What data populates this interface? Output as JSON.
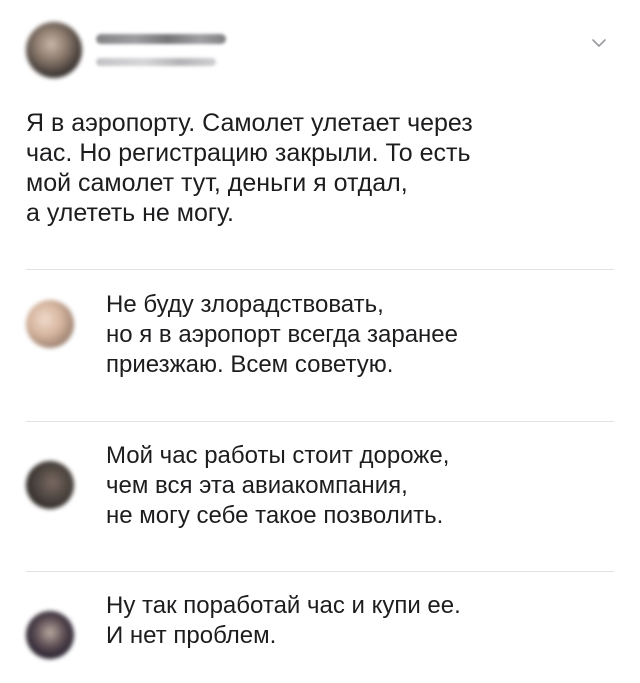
{
  "post": {
    "author_avatar": "author-avatar",
    "menu_icon": "chevron-down-icon",
    "text_lines": [
      "Я в аэропорту. Самолет улетает через",
      "час. Но регистрацию закрыли. То есть",
      "мой самолет тут, деньги я отдал,",
      "а улететь не могу."
    ]
  },
  "comments": [
    {
      "lines": [
        "Не буду злорадствовать,",
        "но я в аэропорт всегда заранее",
        "приезжаю. Всем советую."
      ]
    },
    {
      "lines": [
        "Мой час работы стоит дороже,",
        "чем вся эта авиакомпания,",
        "не могу себе такое позволить."
      ]
    },
    {
      "lines": [
        "Ну так поработай час и купи ее.",
        "И нет проблем."
      ]
    }
  ],
  "colors": {
    "text": "#1d1d1f",
    "divider": "#e3e3e6",
    "chevron": "#9a9aa0",
    "background": "#ffffff"
  }
}
